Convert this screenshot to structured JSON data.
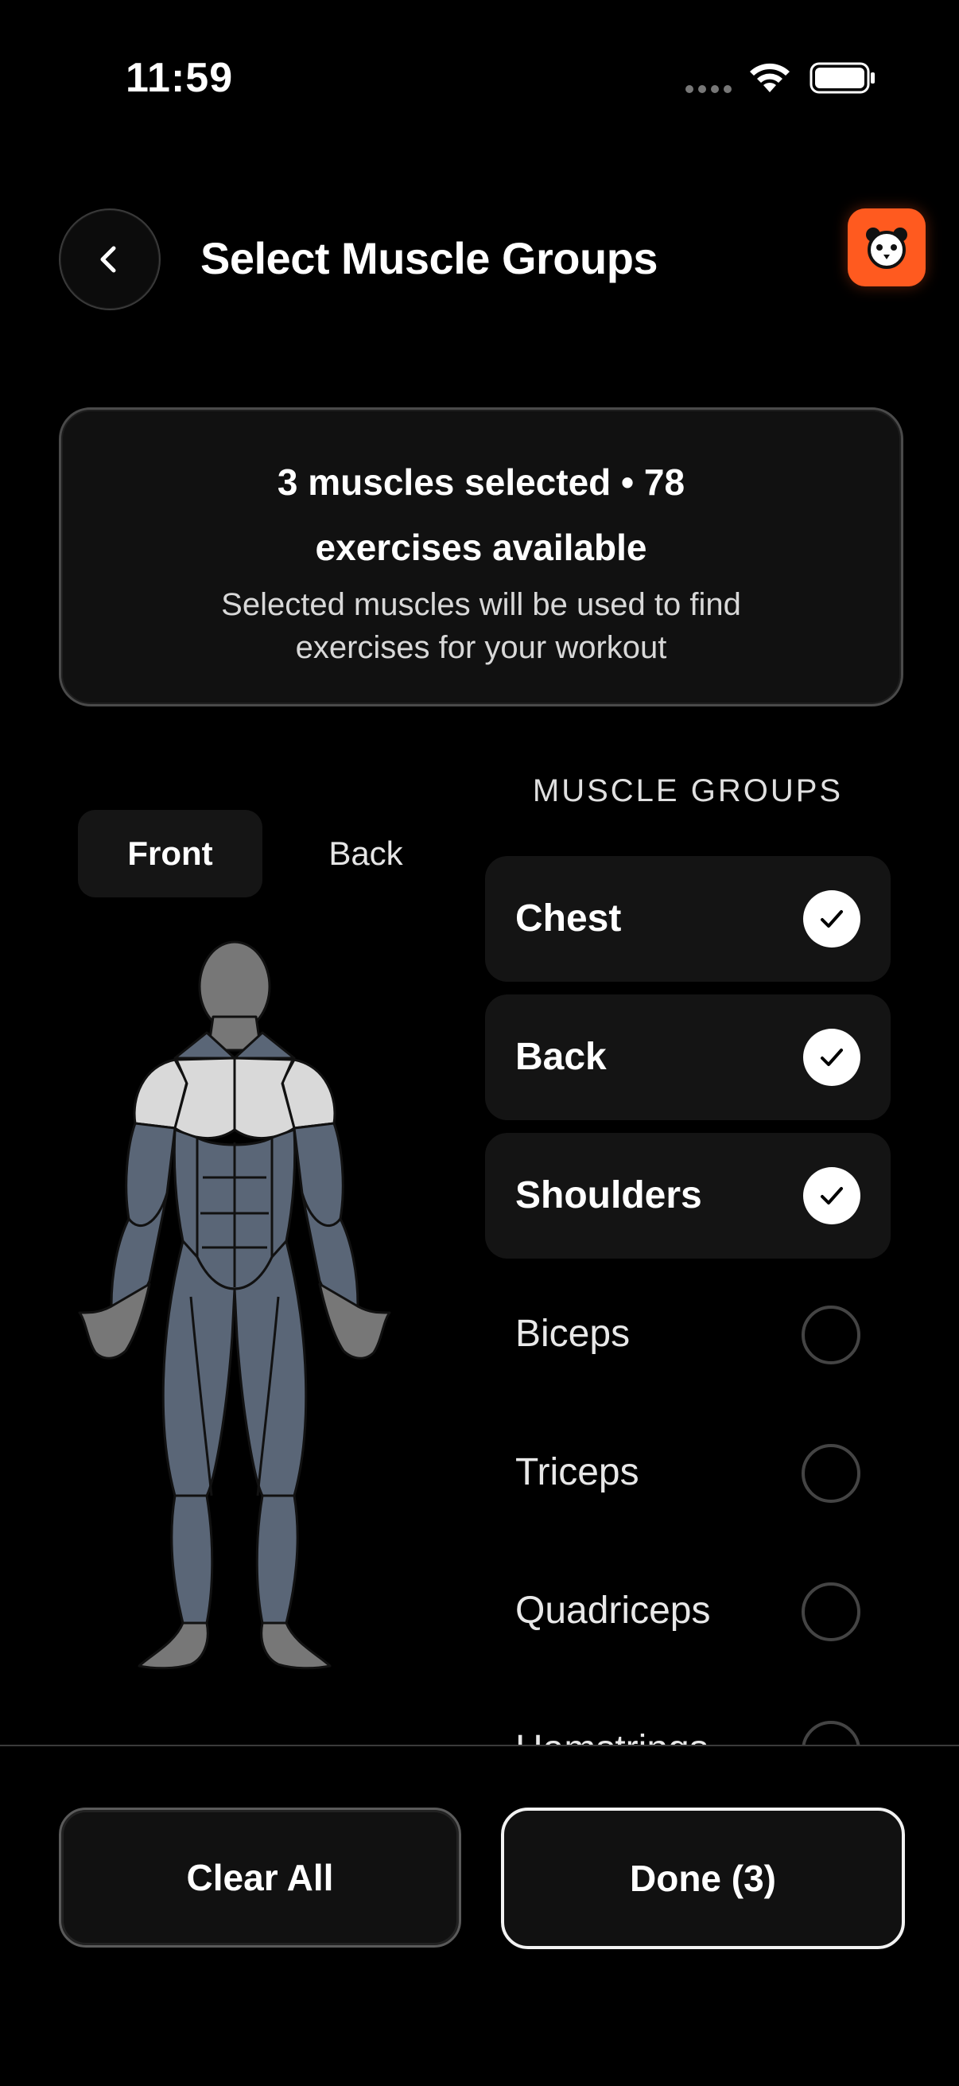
{
  "status_bar": {
    "time": "11:59"
  },
  "header": {
    "title": "Select Muscle Groups"
  },
  "summary": {
    "line1": "3  muscles selected • 78",
    "line2": "exercises available",
    "subtitle": "Selected muscles will be used to find exercises for your workout"
  },
  "view_toggle": {
    "front": "Front",
    "back": "Back",
    "active": "Front"
  },
  "muscle_groups": {
    "heading": "MUSCLE GROUPS",
    "items": [
      {
        "label": "Chest",
        "selected": true
      },
      {
        "label": "Back",
        "selected": true
      },
      {
        "label": "Shoulders",
        "selected": true
      },
      {
        "label": "Biceps",
        "selected": false
      },
      {
        "label": "Triceps",
        "selected": false
      },
      {
        "label": "Quadriceps",
        "selected": false
      },
      {
        "label": "Hamstrings",
        "selected": false
      }
    ]
  },
  "footer": {
    "clear_label": "Clear All",
    "done_label": "Done (3)"
  },
  "colors": {
    "accent": "#ff5a1f",
    "muscle_default": "#5a6677",
    "muscle_selected": "#d9d9d9",
    "head_gray": "#777777"
  }
}
